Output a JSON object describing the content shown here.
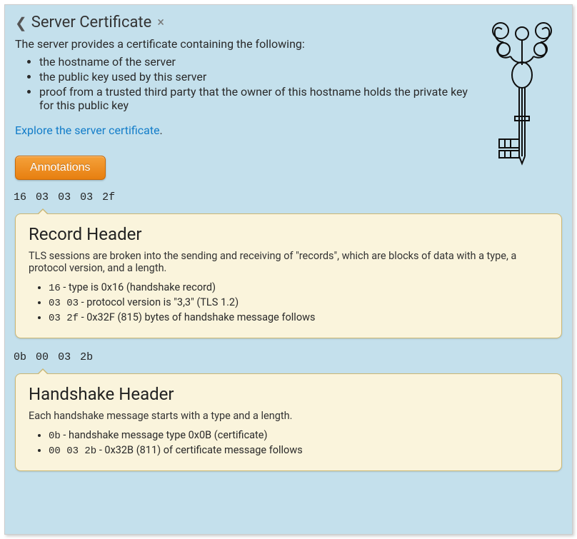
{
  "title": "Server Certificate",
  "intro": "The server provides a certificate containing the following:",
  "introList": [
    "the hostname of the server",
    "the public key used by this server",
    "proof from a trusted third party that the owner of this hostname holds the private key for this public key"
  ],
  "exploreLink": "Explore the server certificate",
  "annotButton": "Annotations",
  "blocks": [
    {
      "hex": [
        "16",
        "03",
        "03",
        "03",
        "2f"
      ],
      "title": "Record Header",
      "desc": "TLS sessions are broken into the sending and receiving of \"records\", which are blocks of data with a type, a protocol version, and a length.",
      "items": [
        {
          "code": "16",
          "tail": " - type is 0x16 (handshake record)"
        },
        {
          "code": "03 03",
          "tail": " - protocol version is \"3,3\" (TLS 1.2)"
        },
        {
          "code": "03 2f",
          "tail": " - 0x32F (815) bytes of handshake message follows"
        }
      ]
    },
    {
      "hex": [
        "0b",
        "00",
        "03",
        "2b"
      ],
      "title": "Handshake Header",
      "desc": "Each handshake message starts with a type and a length.",
      "items": [
        {
          "code": "0b",
          "tail": " - handshake message type 0x0B (certificate)"
        },
        {
          "code": "00 03 2b",
          "tail": " - 0x32B (811) of certificate message follows"
        }
      ]
    }
  ]
}
